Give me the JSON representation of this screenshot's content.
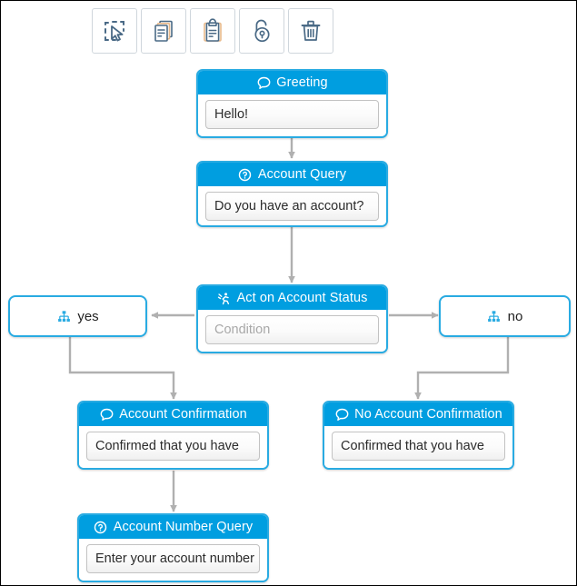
{
  "toolbar": {
    "buttons": [
      {
        "name": "select-tool",
        "icon": "select-cursor-icon",
        "label": "Select"
      },
      {
        "name": "copy-tool",
        "icon": "copy-icon",
        "label": "Copy"
      },
      {
        "name": "paste-tool",
        "icon": "clipboard-paste-icon",
        "label": "Paste"
      },
      {
        "name": "lock-tool",
        "icon": "unlock-icon",
        "label": "Unlock"
      },
      {
        "name": "delete-tool",
        "icon": "trash-icon",
        "label": "Delete"
      }
    ]
  },
  "colors": {
    "header_blue": "#009EE0",
    "node_border_blue": "#29ABE2",
    "connector_grey": "#b0b0b0",
    "placeholder_grey": "#a8a8a8",
    "icon_blue": "#29ABE2"
  },
  "diagram": {
    "nodes": [
      {
        "id": "greeting",
        "title": "Greeting",
        "icon": "speech-bubble-icon",
        "body": "Hello!",
        "body_is_placeholder": false
      },
      {
        "id": "account-query",
        "title": "Account Query",
        "icon": "question-circle-icon",
        "body": "Do you have an account?",
        "body_is_placeholder": false
      },
      {
        "id": "act-on-account-status",
        "title": "Act on Account Status",
        "icon": "runner-icon",
        "body": "Condition",
        "body_is_placeholder": true
      },
      {
        "id": "account-confirmation",
        "title": "Account Confirmation",
        "icon": "speech-bubble-icon",
        "body": "Confirmed that you have",
        "body_is_placeholder": false
      },
      {
        "id": "no-account-confirmation",
        "title": "No Account Confirmation",
        "icon": "speech-bubble-icon",
        "body": "Confirmed that you have",
        "body_is_placeholder": false
      },
      {
        "id": "account-number-query",
        "title": "Account Number Query",
        "icon": "question-circle-icon",
        "body": "Enter your account number",
        "body_is_placeholder": false
      }
    ],
    "branches": [
      {
        "id": "branch-yes",
        "label": "yes",
        "icon": "sitemap-icon"
      },
      {
        "id": "branch-no",
        "label": "no",
        "icon": "sitemap-icon"
      }
    ]
  }
}
